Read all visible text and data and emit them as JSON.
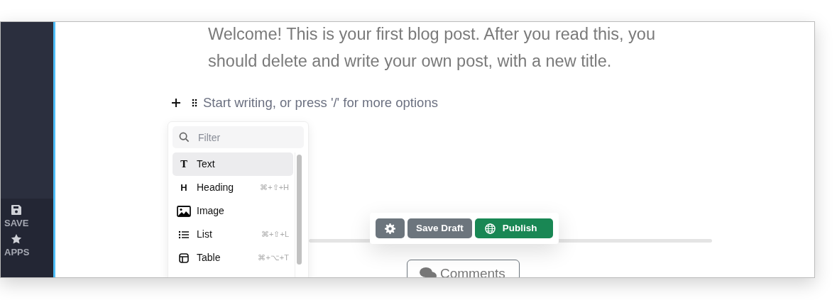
{
  "sidebar": {
    "items": [
      {
        "label": "SAVE",
        "kind": "save"
      },
      {
        "label": "APPS",
        "kind": "apps"
      }
    ]
  },
  "editor": {
    "paragraph_lines": [
      "Welcome! This is your first blog post. After you read this, you",
      "should delete and write your own post, with a new title."
    ],
    "block_placeholder": "Start writing, or press '/' for more options"
  },
  "insert_menu": {
    "filter_placeholder": "Filter",
    "items": [
      {
        "kind": "text",
        "glyph": "T",
        "label": "Text",
        "selected": true
      },
      {
        "kind": "heading",
        "glyph": "H",
        "label": "Heading",
        "shortcut": "⌘+⇧+H",
        "selected": false
      },
      {
        "kind": "image",
        "label": "Image",
        "selected": false
      },
      {
        "kind": "list",
        "label": "List",
        "shortcut": "⌘+⇧+L",
        "selected": false
      },
      {
        "kind": "table",
        "label": "Table",
        "shortcut": "⌘+⌥+T",
        "selected": false
      }
    ]
  },
  "toolbar": {
    "buttons": [
      {
        "kind": "settings"
      },
      {
        "kind": "draft",
        "label": "Save Draft"
      },
      {
        "kind": "publish",
        "label": "Publish"
      }
    ]
  },
  "comments_button": {
    "label": "Comments"
  }
}
